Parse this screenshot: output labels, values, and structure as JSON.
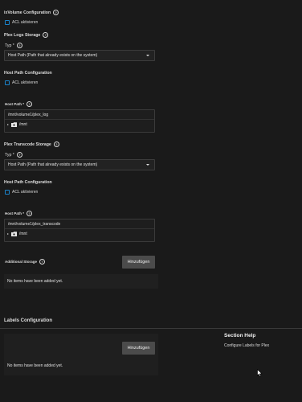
{
  "volume_config": {
    "title": "ixVolume Configuration",
    "acl_label": "ACL aktivieren"
  },
  "plex_logs": {
    "title": "Plex Logs Storage",
    "type_label": "Typ *",
    "type_value": "Host Path (Path that already exists on the system)",
    "host_path_config_title": "Host Path Configuration",
    "acl_label": "ACL aktivieren",
    "host_path_label": "Host Path *",
    "host_path_value": "/mnt/volume1/plex_log",
    "tree_root": "/mnt"
  },
  "plex_transcode": {
    "title": "Plex Transcode Storage",
    "type_label": "Typ *",
    "type_value": "Host Path (Path that already exists on the system)",
    "host_path_config_title": "Host Path Configuration",
    "acl_label": "ACL aktivieren",
    "host_path_label": "Host Path *",
    "host_path_value": "/mnt/volume1/plex_transcode",
    "tree_root": "/mnt"
  },
  "additional_storage": {
    "title": "Additional Storage",
    "add_button": "Hinzufügen",
    "empty_text": "No items have been added yet."
  },
  "labels_config": {
    "title": "Labels Configuration",
    "add_button": "Hinzufügen",
    "empty_text": "No items have been added yet."
  },
  "section_help": {
    "title": "Section Help",
    "text": "Configure Labels for Plex"
  },
  "icons": {
    "help": "help-circle-icon",
    "folder": "folder-icon",
    "caret": "chevron-down-icon",
    "expand": "chevron-right-icon"
  }
}
